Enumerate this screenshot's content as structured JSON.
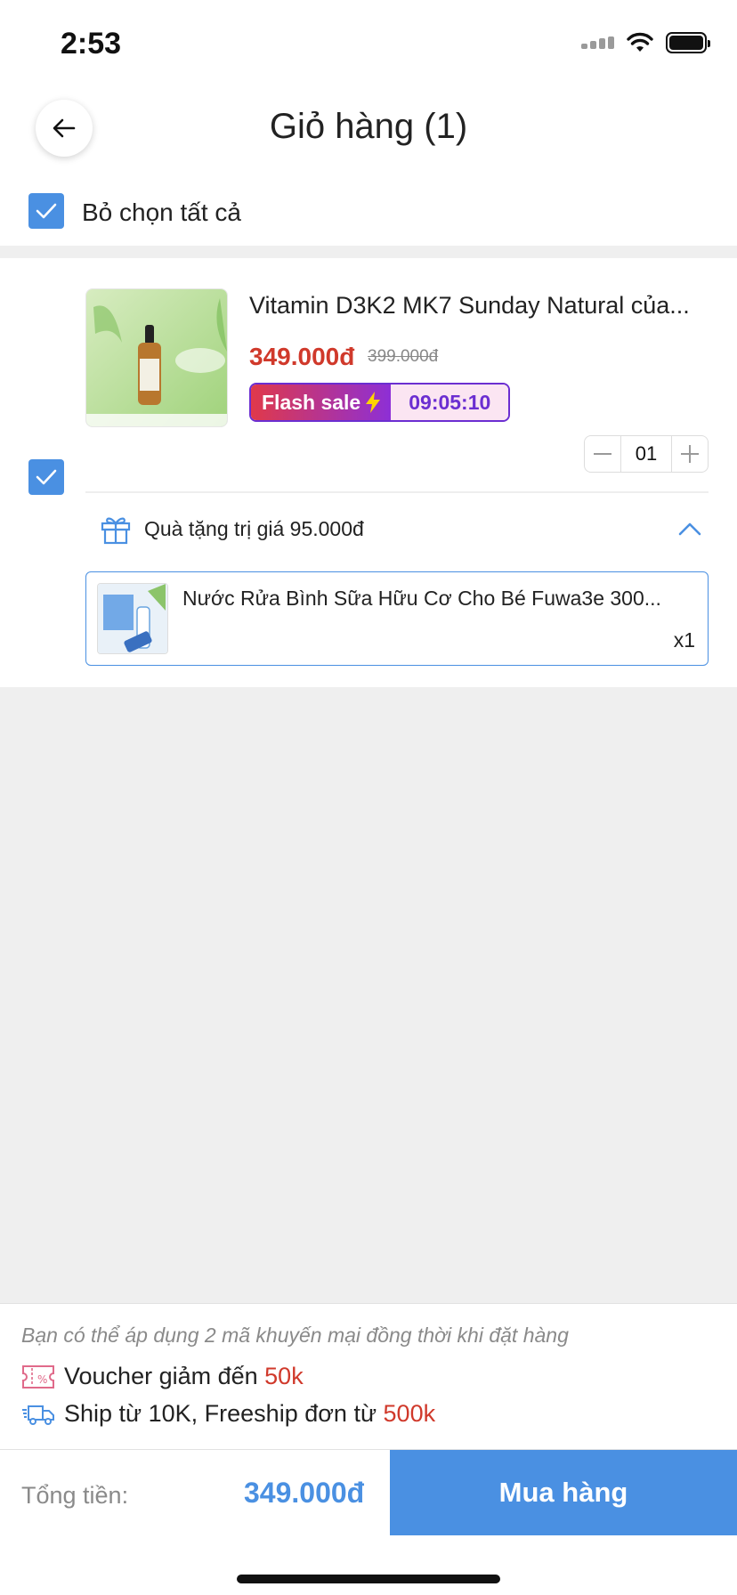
{
  "status_bar": {
    "time": "2:53"
  },
  "header": {
    "title": "Giỏ hàng (1)"
  },
  "select_all": {
    "label": "Bỏ chọn tất cả",
    "checked": true
  },
  "cart": {
    "items": [
      {
        "name": "Vitamin D3K2 MK7 Sunday Natural của...",
        "price": "349.000đ",
        "original_price": "399.000đ",
        "flash_sale_label": "Flash sale",
        "flash_sale_timer": "09:05:10",
        "quantity": "01",
        "checked": true,
        "gift": {
          "label": "Quà tặng trị giá 95.000đ",
          "product_name": "Nước Rửa Bình Sữa Hữu Cơ Cho Bé Fuwa3e 300...",
          "quantity": "x1"
        }
      }
    ]
  },
  "promo": {
    "note": "Bạn có thể áp dụng 2 mã khuyến mại đồng thời khi đặt hàng",
    "voucher_text": "Voucher giảm đến ",
    "voucher_amount": "50k",
    "ship_text": "Ship từ 10K, Freeship đơn từ ",
    "ship_amount": "500k"
  },
  "footer": {
    "total_label": "Tổng tiền:",
    "total_value": "349.000đ",
    "buy_label": "Mua hàng"
  },
  "colors": {
    "accent": "#4a90e2",
    "price": "#d0392b",
    "flash": "#6b2ed1"
  }
}
